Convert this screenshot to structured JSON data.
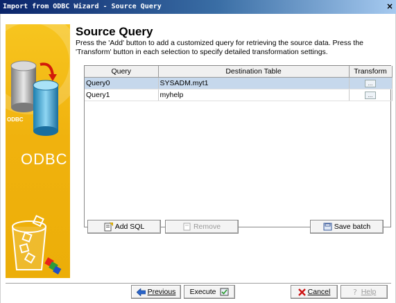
{
  "window": {
    "title": "Import from ODBC Wizard - Source Query",
    "close_glyph": "×"
  },
  "sidepanel": {
    "label": "ODBC"
  },
  "page": {
    "heading": "Source Query",
    "description": "Press the 'Add' button to add a customized query for retrieving the source data. Press the 'Transform' button in each selection to specify detailed transformation settings."
  },
  "table": {
    "columns": [
      "Query",
      "Destination Table",
      "Transform"
    ],
    "rows": [
      {
        "query": "Query0",
        "destination": "SYSADM.myt1",
        "transform": "...",
        "selected": true
      },
      {
        "query": "Query1",
        "destination": "myhelp",
        "transform": "...",
        "selected": false
      }
    ]
  },
  "actions": {
    "add_sql": "Add SQL",
    "remove": "Remove",
    "save_batch": "Save batch"
  },
  "footer": {
    "previous": "Previous",
    "execute": "Execute",
    "cancel": "Cancel",
    "help": "Help"
  },
  "icons": {
    "add_sql": "add-query-icon",
    "remove": "remove-icon",
    "save_batch": "save-icon",
    "previous": "arrow-left-icon",
    "execute": "execute-icon",
    "cancel": "cancel-x-icon",
    "help": "help-icon"
  },
  "colors": {
    "title_bar_start": "#0a246a",
    "side_panel": "#f0b20e",
    "selected_row": "#c6d8ec",
    "cancel_icon": "#cc1111"
  }
}
